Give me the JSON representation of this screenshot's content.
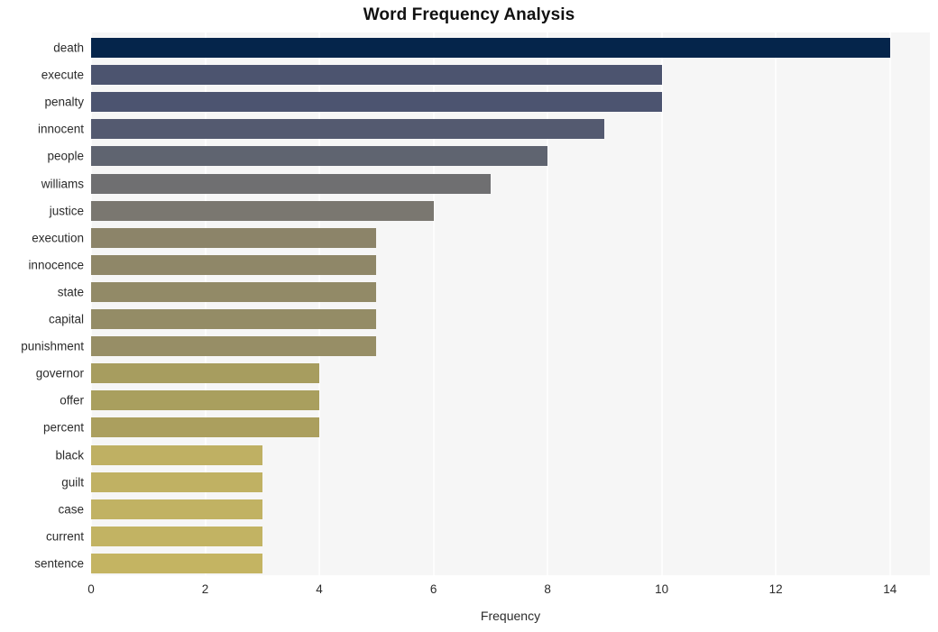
{
  "chart_data": {
    "type": "bar",
    "orientation": "horizontal",
    "title": "Word Frequency Analysis",
    "xlabel": "Frequency",
    "ylabel": "",
    "xlim": [
      0,
      14.7
    ],
    "ylim": [
      0,
      20
    ],
    "xticks": [
      0,
      2,
      4,
      6,
      8,
      10,
      12,
      14
    ],
    "xticklabels": [
      "0",
      "2",
      "4",
      "6",
      "8",
      "10",
      "12",
      "14"
    ],
    "grid": true,
    "grid_axis": "x",
    "legend": null,
    "categories": [
      "death",
      "execute",
      "penalty",
      "innocent",
      "people",
      "williams",
      "justice",
      "execution",
      "innocence",
      "state",
      "capital",
      "punishment",
      "governor",
      "offer",
      "percent",
      "black",
      "guilt",
      "case",
      "current",
      "sentence"
    ],
    "values": [
      14,
      10,
      10,
      9,
      8,
      7,
      6,
      5,
      5,
      5,
      5,
      5,
      4,
      4,
      4,
      3,
      3,
      3,
      3,
      3
    ],
    "bar_colors": [
      "#05254b",
      "#4c546f",
      "#4c5470",
      "#545a70",
      "#5f6470",
      "#6f6f71",
      "#7a7770",
      "#8c8469",
      "#8f8768",
      "#928a67",
      "#948c66",
      "#978e66",
      "#a79d5f",
      "#a99f5e",
      "#ab9f5e",
      "#bfb063",
      "#c0b163",
      "#c1b263",
      "#c2b363",
      "#c4b462"
    ],
    "plot_bgcolor": "#f6f6f6",
    "grid_color": "#fdfdfd",
    "figure_bgcolor": "#ffffff",
    "title_color": "#111111",
    "tick_color": "#2b2b2b"
  }
}
